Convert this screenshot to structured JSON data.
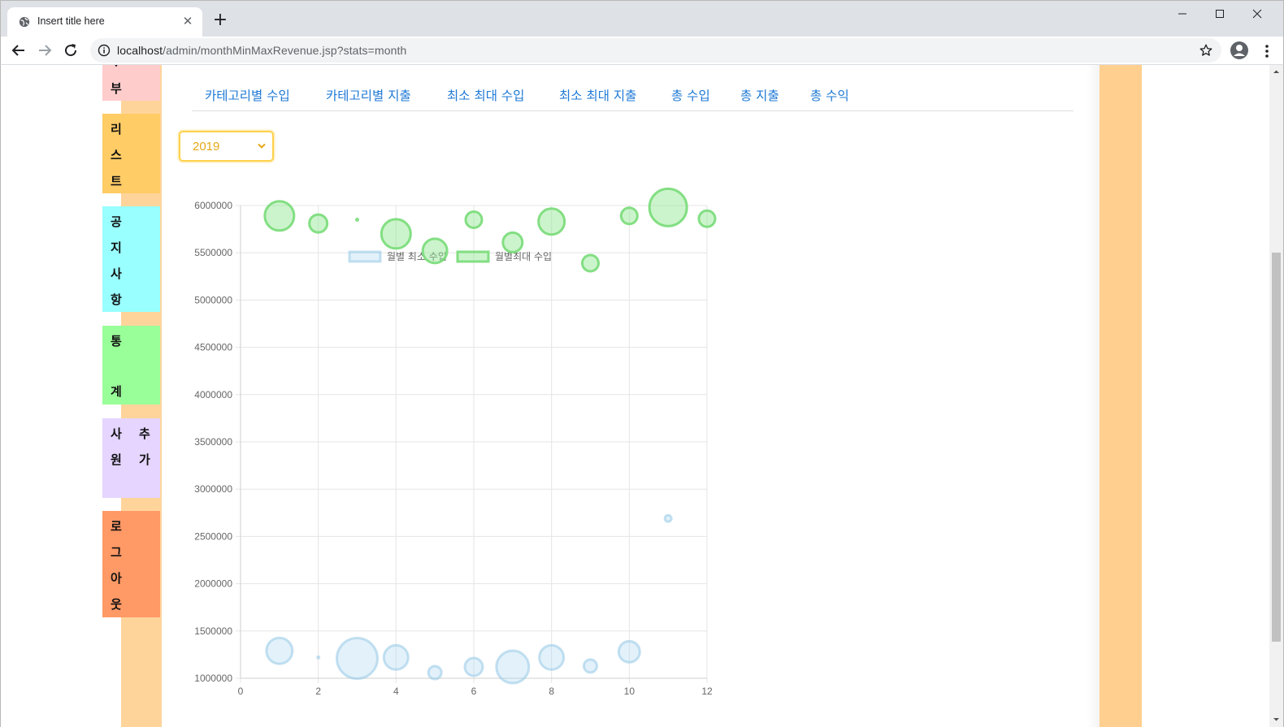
{
  "browser": {
    "tab_title": "Insert title here",
    "url_host": "localhost",
    "url_path": "/admin/monthMinMaxRevenue.jsp?stats=month"
  },
  "sidebar": {
    "items": [
      {
        "label": "부",
        "color": "#ffcccc"
      },
      {
        "label": "리스트",
        "color": "#ffcc66"
      },
      {
        "label": "공지사항",
        "color": "#99ffff"
      },
      {
        "label": "통계",
        "color": "#99ff99"
      },
      {
        "label": "사원추가",
        "color": "#e5d5ff"
      },
      {
        "label": "로그아웃",
        "color": "#ff9966"
      }
    ]
  },
  "nav": {
    "links": [
      "카테고리별 수입",
      "카테고리별 지출",
      "최소 최대 수입",
      "최소 최대 지출",
      "총 수입",
      "총 지출",
      "총 수익"
    ]
  },
  "year_select": {
    "selected": "2019"
  },
  "chart_data": {
    "type": "bubble",
    "legend": [
      "월별 최소 수입",
      "월별최대 수입"
    ],
    "legend_position": "top",
    "grid": true,
    "xlim": [
      0,
      12
    ],
    "ylim": [
      1000000,
      6000000
    ],
    "x_ticks": [
      "0",
      "2",
      "4",
      "6",
      "8",
      "10",
      "12"
    ],
    "y_ticks": [
      "1000000",
      "1500000",
      "2000000",
      "2500000",
      "3000000",
      "3500000",
      "4000000",
      "4500000",
      "5000000",
      "5500000",
      "6000000"
    ],
    "series": [
      {
        "name": "월별 최소 수입",
        "color": "#add8f0",
        "points": [
          {
            "x": 1,
            "y": 1290000,
            "r": 16
          },
          {
            "x": 2,
            "y": 1220000,
            "r": 1
          },
          {
            "x": 3,
            "y": 1210000,
            "r": 25
          },
          {
            "x": 4,
            "y": 1220000,
            "r": 15
          },
          {
            "x": 5,
            "y": 1060000,
            "r": 8
          },
          {
            "x": 6,
            "y": 1120000,
            "r": 11
          },
          {
            "x": 7,
            "y": 1120000,
            "r": 20
          },
          {
            "x": 8,
            "y": 1220000,
            "r": 15
          },
          {
            "x": 9,
            "y": 1130000,
            "r": 8
          },
          {
            "x": 10,
            "y": 1280000,
            "r": 13
          },
          {
            "x": 11,
            "y": 2690000,
            "r": 4
          },
          {
            "x": 12,
            "y": 1060000,
            "r": 0
          }
        ]
      },
      {
        "name": "월별최대 수입",
        "color": "#8fe68f",
        "points": [
          {
            "x": 1,
            "y": 5890000,
            "r": 18
          },
          {
            "x": 2,
            "y": 5810000,
            "r": 11
          },
          {
            "x": 3,
            "y": 5850000,
            "r": 1
          },
          {
            "x": 4,
            "y": 5700000,
            "r": 18
          },
          {
            "x": 5,
            "y": 5520000,
            "r": 15
          },
          {
            "x": 6,
            "y": 5850000,
            "r": 10
          },
          {
            "x": 7,
            "y": 5610000,
            "r": 12
          },
          {
            "x": 8,
            "y": 5830000,
            "r": 16
          },
          {
            "x": 9,
            "y": 5390000,
            "r": 10
          },
          {
            "x": 10,
            "y": 5890000,
            "r": 10
          },
          {
            "x": 11,
            "y": 5980000,
            "r": 23
          },
          {
            "x": 12,
            "y": 5860000,
            "r": 10
          }
        ]
      }
    ]
  }
}
